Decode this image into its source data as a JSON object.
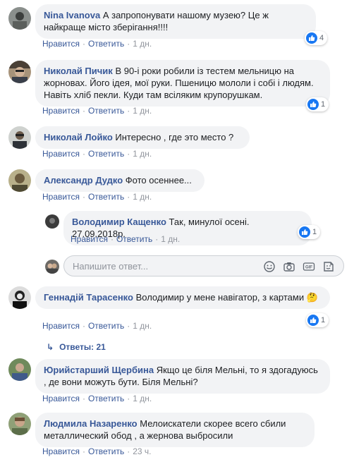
{
  "colors": {
    "link": "#385898",
    "bubble": "#f2f3f5",
    "muted": "#90949c",
    "like": "#1877f2"
  },
  "actions": {
    "like": "Нравится",
    "reply": "Ответить",
    "sep": "·"
  },
  "comments": [
    {
      "author": "Nina Ivanova",
      "text": "А запропонувати нашому музею? Це ж найкраще місто зберігання!!!!",
      "time": "1 дн.",
      "reactions": "4"
    },
    {
      "author": "Николай Пичик",
      "text": "В 90-і роки робили із тестем мельницю на жорновах. Його ідея, мої руки. Пшеницю мололи і собі і людям. Навіть хліб пекли. Куди там всіляким крупорушкам.",
      "time": "1 дн.",
      "reactions": "1"
    },
    {
      "author": "Николай Лойко",
      "text": "Интересно , где это место ?",
      "time": "1 дн."
    },
    {
      "author": "Александр Дудко",
      "text": "Фото осеннее...",
      "time": "1 дн."
    },
    {
      "author": "Володимир Кащенко",
      "text": "Так, минулої осені. 27.09.2018р.",
      "time": "1 дн.",
      "reactions": "1"
    },
    {
      "author": "Геннадій Тарасенко",
      "text": "Володимир у мене навігатор, з картами",
      "emoji": "🤔",
      "time": "1 дн.",
      "reactions": "1"
    },
    {
      "author": "Юрийстарший Щербина",
      "text": "Якщо це біля Мельні, то я здогадуюсь , де вони можуть бути. Біля Мельні?",
      "time": "1 дн."
    },
    {
      "author": "Людмила Назаренко",
      "text": "Мелоискатели скорее всего сбили металлический обод , а жернова выбросили",
      "time": "23 ч."
    }
  ],
  "reply_box": {
    "placeholder": "Напишите ответ..."
  },
  "replies_link": {
    "label": "Ответы: 21"
  },
  "icons": [
    "like-icon",
    "emoji-icon",
    "camera-icon",
    "gif-icon",
    "sticker-icon",
    "reply-arrow-icon"
  ]
}
